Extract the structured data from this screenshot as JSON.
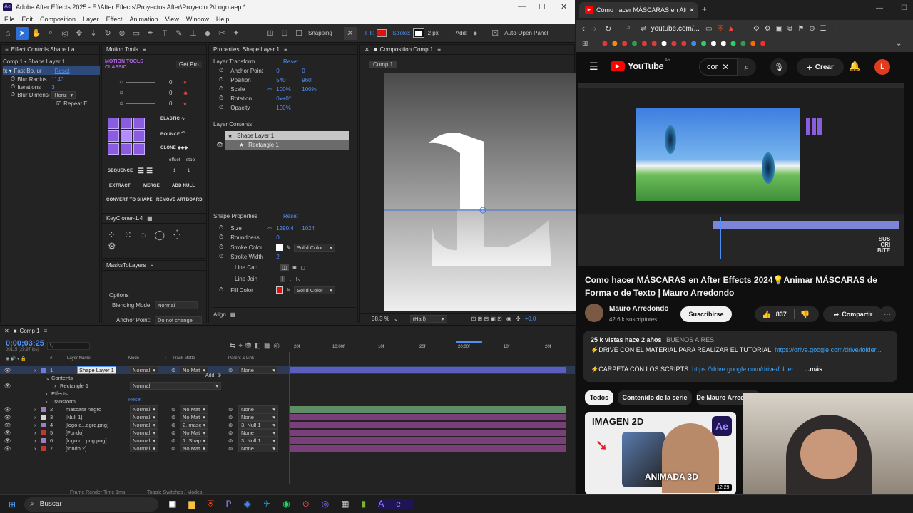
{
  "ae": {
    "title": "Adobe After Effects 2025 - E:\\After Effects\\Proyectos After\\Proyecto ?\\Logo.aep *",
    "menu": [
      "File",
      "Edit",
      "Composition",
      "Layer",
      "Effect",
      "Animation",
      "View",
      "Window",
      "Help"
    ],
    "toolbar": {
      "snapping": "Snapping",
      "fill": "Fill:",
      "stroke": "Stroke:",
      "stroke_px": "2 px",
      "add": "Add:",
      "auto_open": "Auto-Open Panel"
    },
    "effect_controls": {
      "tab": "Effect Controls Shape La",
      "layer": "Comp 1 • Shape Layer 1",
      "effect": "Fast Bo..ur",
      "reset": "Reset",
      "blur_radius_label": "Blur Radius",
      "blur_radius": "1140",
      "iterations_label": "Iterations",
      "iterations": "3",
      "blur_dim_label": "Blur Dimensi",
      "blur_dim": "Horiz",
      "repeat_edge": "Repeat E"
    },
    "motion_tools": {
      "tab": "Motion Tools",
      "logo": "MOTION TOOLS",
      "logo2": "CLASSIC",
      "get_pro": "Get Pro",
      "vals": [
        "0",
        "0",
        "0"
      ],
      "elastic": "ELASTIC",
      "bounce": "BOUNCE",
      "clone": "CLONE",
      "offset": "offset",
      "stop": "stop",
      "sequence": "SEQUENCE",
      "seq_a": "1",
      "seq_b": "1",
      "extract": "EXTRACT",
      "merge": "MERGE",
      "add_null": "ADD NULL",
      "convert": "CONVERT TO SHAPE",
      "remove": "REMOVE ARTBOARD"
    },
    "keycloner": {
      "tab": "KeyCloner-1.4"
    },
    "masks": {
      "tab": "MasksToLayers",
      "options": "Options",
      "blend_label": "Blending Mode:",
      "blend_val": "Normal",
      "anchor_label": "Anchor Point:",
      "anchor_val": "Do not change"
    },
    "properties": {
      "tab": "Properties: Shape Layer 1",
      "layer_transform": "Layer Transform",
      "reset": "Reset",
      "anchor_label": "Anchor Point",
      "anchor_x": "0",
      "anchor_y": "0",
      "position_label": "Position",
      "position_x": "540",
      "position_y": "960",
      "scale_label": "Scale",
      "scale_x": "100%",
      "scale_y": "100%",
      "rotation_label": "Rotation",
      "rotation": "0x+0°",
      "opacity_label": "Opacity",
      "opacity": "100%",
      "layer_contents": "Layer Contents",
      "content_1": "Shape Layer 1",
      "content_2": "Rectangle 1",
      "shape_props": "Shape Properties",
      "size_label": "Size",
      "size_w": "1290.4",
      "size_h": "1024",
      "roundness_label": "Roundness",
      "roundness": "0",
      "stroke_color_label": "Stroke Color",
      "stroke_color_mode": "Solid Color",
      "stroke_width_label": "Stroke Width",
      "stroke_width": "2",
      "line_cap_label": "Line Cap",
      "line_join_label": "Line Join",
      "fill_color_label": "Fill Color",
      "fill_color_mode": "Solid Color",
      "align": "Align"
    },
    "composition": {
      "tab": "Composition Comp 1",
      "crumb": "Comp 1",
      "zoom": "38.3 %",
      "quality": "(Half)",
      "exposure": "+0.0"
    },
    "timeline": {
      "tab": "Comp 1",
      "timecode": "0;00;03;25",
      "timecode_sub": "00115 (29.97 fps)",
      "search_placeholder": "Q",
      "cols": {
        "num": "#",
        "name": "Layer Name",
        "mode": "Mode",
        "t": "T",
        "track": "Track Matte",
        "parent": "Parent & Link"
      },
      "ruler": [
        "20f",
        "10:00f",
        "10f",
        "20f",
        "20:00f",
        "10f",
        "20f"
      ],
      "layers": [
        {
          "num": "1",
          "name": "Shape Layer 1",
          "mode": "Normal",
          "track": "No Mat",
          "parent": "None",
          "color": "#6f7bd8",
          "bar": "#5a5fbf"
        },
        {
          "num": "",
          "name": "Contents",
          "mode": "",
          "track": "",
          "parent": "",
          "color": "",
          "bar": ""
        },
        {
          "num": "",
          "name": "Rectangle 1",
          "mode": "Normal",
          "track": "",
          "parent": "",
          "color": "",
          "bar": ""
        },
        {
          "num": "",
          "name": "Effects",
          "mode": "",
          "track": "",
          "parent": "",
          "color": "",
          "bar": ""
        },
        {
          "num": "",
          "name": "Transform",
          "mode": "",
          "track": "",
          "parent": "",
          "color": "",
          "bar": ""
        },
        {
          "num": "2",
          "name": "mascara negro",
          "mode": "Normal",
          "track": "No Mat",
          "parent": "None",
          "color": "#a07cc0",
          "bar": "#5f8e66"
        },
        {
          "num": "3",
          "name": "[Null 1]",
          "mode": "Normal",
          "track": "No Mat",
          "parent": "None",
          "color": "#d5d5d5",
          "bar": "#7a3f7a"
        },
        {
          "num": "4",
          "name": "[logo c...egro.png]",
          "mode": "Normal",
          "track": "2. masc",
          "parent": "3. Null 1",
          "color": "#a07cc0",
          "bar": "#7a3f7a"
        },
        {
          "num": "5",
          "name": "[Fondo]",
          "mode": "Normal",
          "track": "No Mat",
          "parent": "None",
          "color": "#c0392b",
          "bar": "#7a3f7a"
        },
        {
          "num": "6",
          "name": "[logo c...png.png]",
          "mode": "Normal",
          "track": "1. Shap",
          "parent": "3. Null 1",
          "color": "#a07cc0",
          "bar": "#7a3f7a"
        },
        {
          "num": "7",
          "name": "[fondo 2]",
          "mode": "Normal",
          "track": "No Mat",
          "parent": "None",
          "color": "#c0392b",
          "bar": "#7a3f7a"
        }
      ],
      "add": "Add:",
      "reset": "Reset",
      "frame_render": "Frame Render Time  1ms",
      "toggle": "Toggle Switches / Modes"
    }
  },
  "youtube": {
    "tab_title": "Cómo hacer MÁSCARAS en After",
    "url": "youtube.com/...",
    "search": "cor",
    "create": "Crear",
    "avatar": "L",
    "region": "AR",
    "video_title": "Como hacer MÁSCARAS en After Effects 2024💡Animar MÁSCARAS de Forma o de Texto | Mauro Arredondo",
    "channel": "Mauro Arredondo",
    "subs": "42.6 k suscriptores",
    "subscribe": "Suscribirse",
    "likes": "837",
    "share": "Compartir",
    "views": "25 k vistas  hace 2 años",
    "location": "BUENOS AIRES",
    "desc1": "⚡DRIVE CON EL MATERIAL PARA REALIZAR EL TUTORIAL: ",
    "link1": "https://drive.google.com/drive/folder...",
    "desc2": "⚡CARPETA CON LOS SCRIPTS: ",
    "link2": "https://drive.google.com/drive/folder...",
    "more": "...más",
    "chips": [
      "Todos",
      "Contenido de la serie",
      "De Mauro Arredondo"
    ],
    "thumb_top": "IMAGEN 2D",
    "thumb_bottom": "ANIMADA 3D",
    "thumb_ae": "Ae",
    "duration": "12:29",
    "sus": "SUS",
    "cri": "CRI",
    "bite": "BITE"
  },
  "taskbar": {
    "search": "Buscar"
  }
}
